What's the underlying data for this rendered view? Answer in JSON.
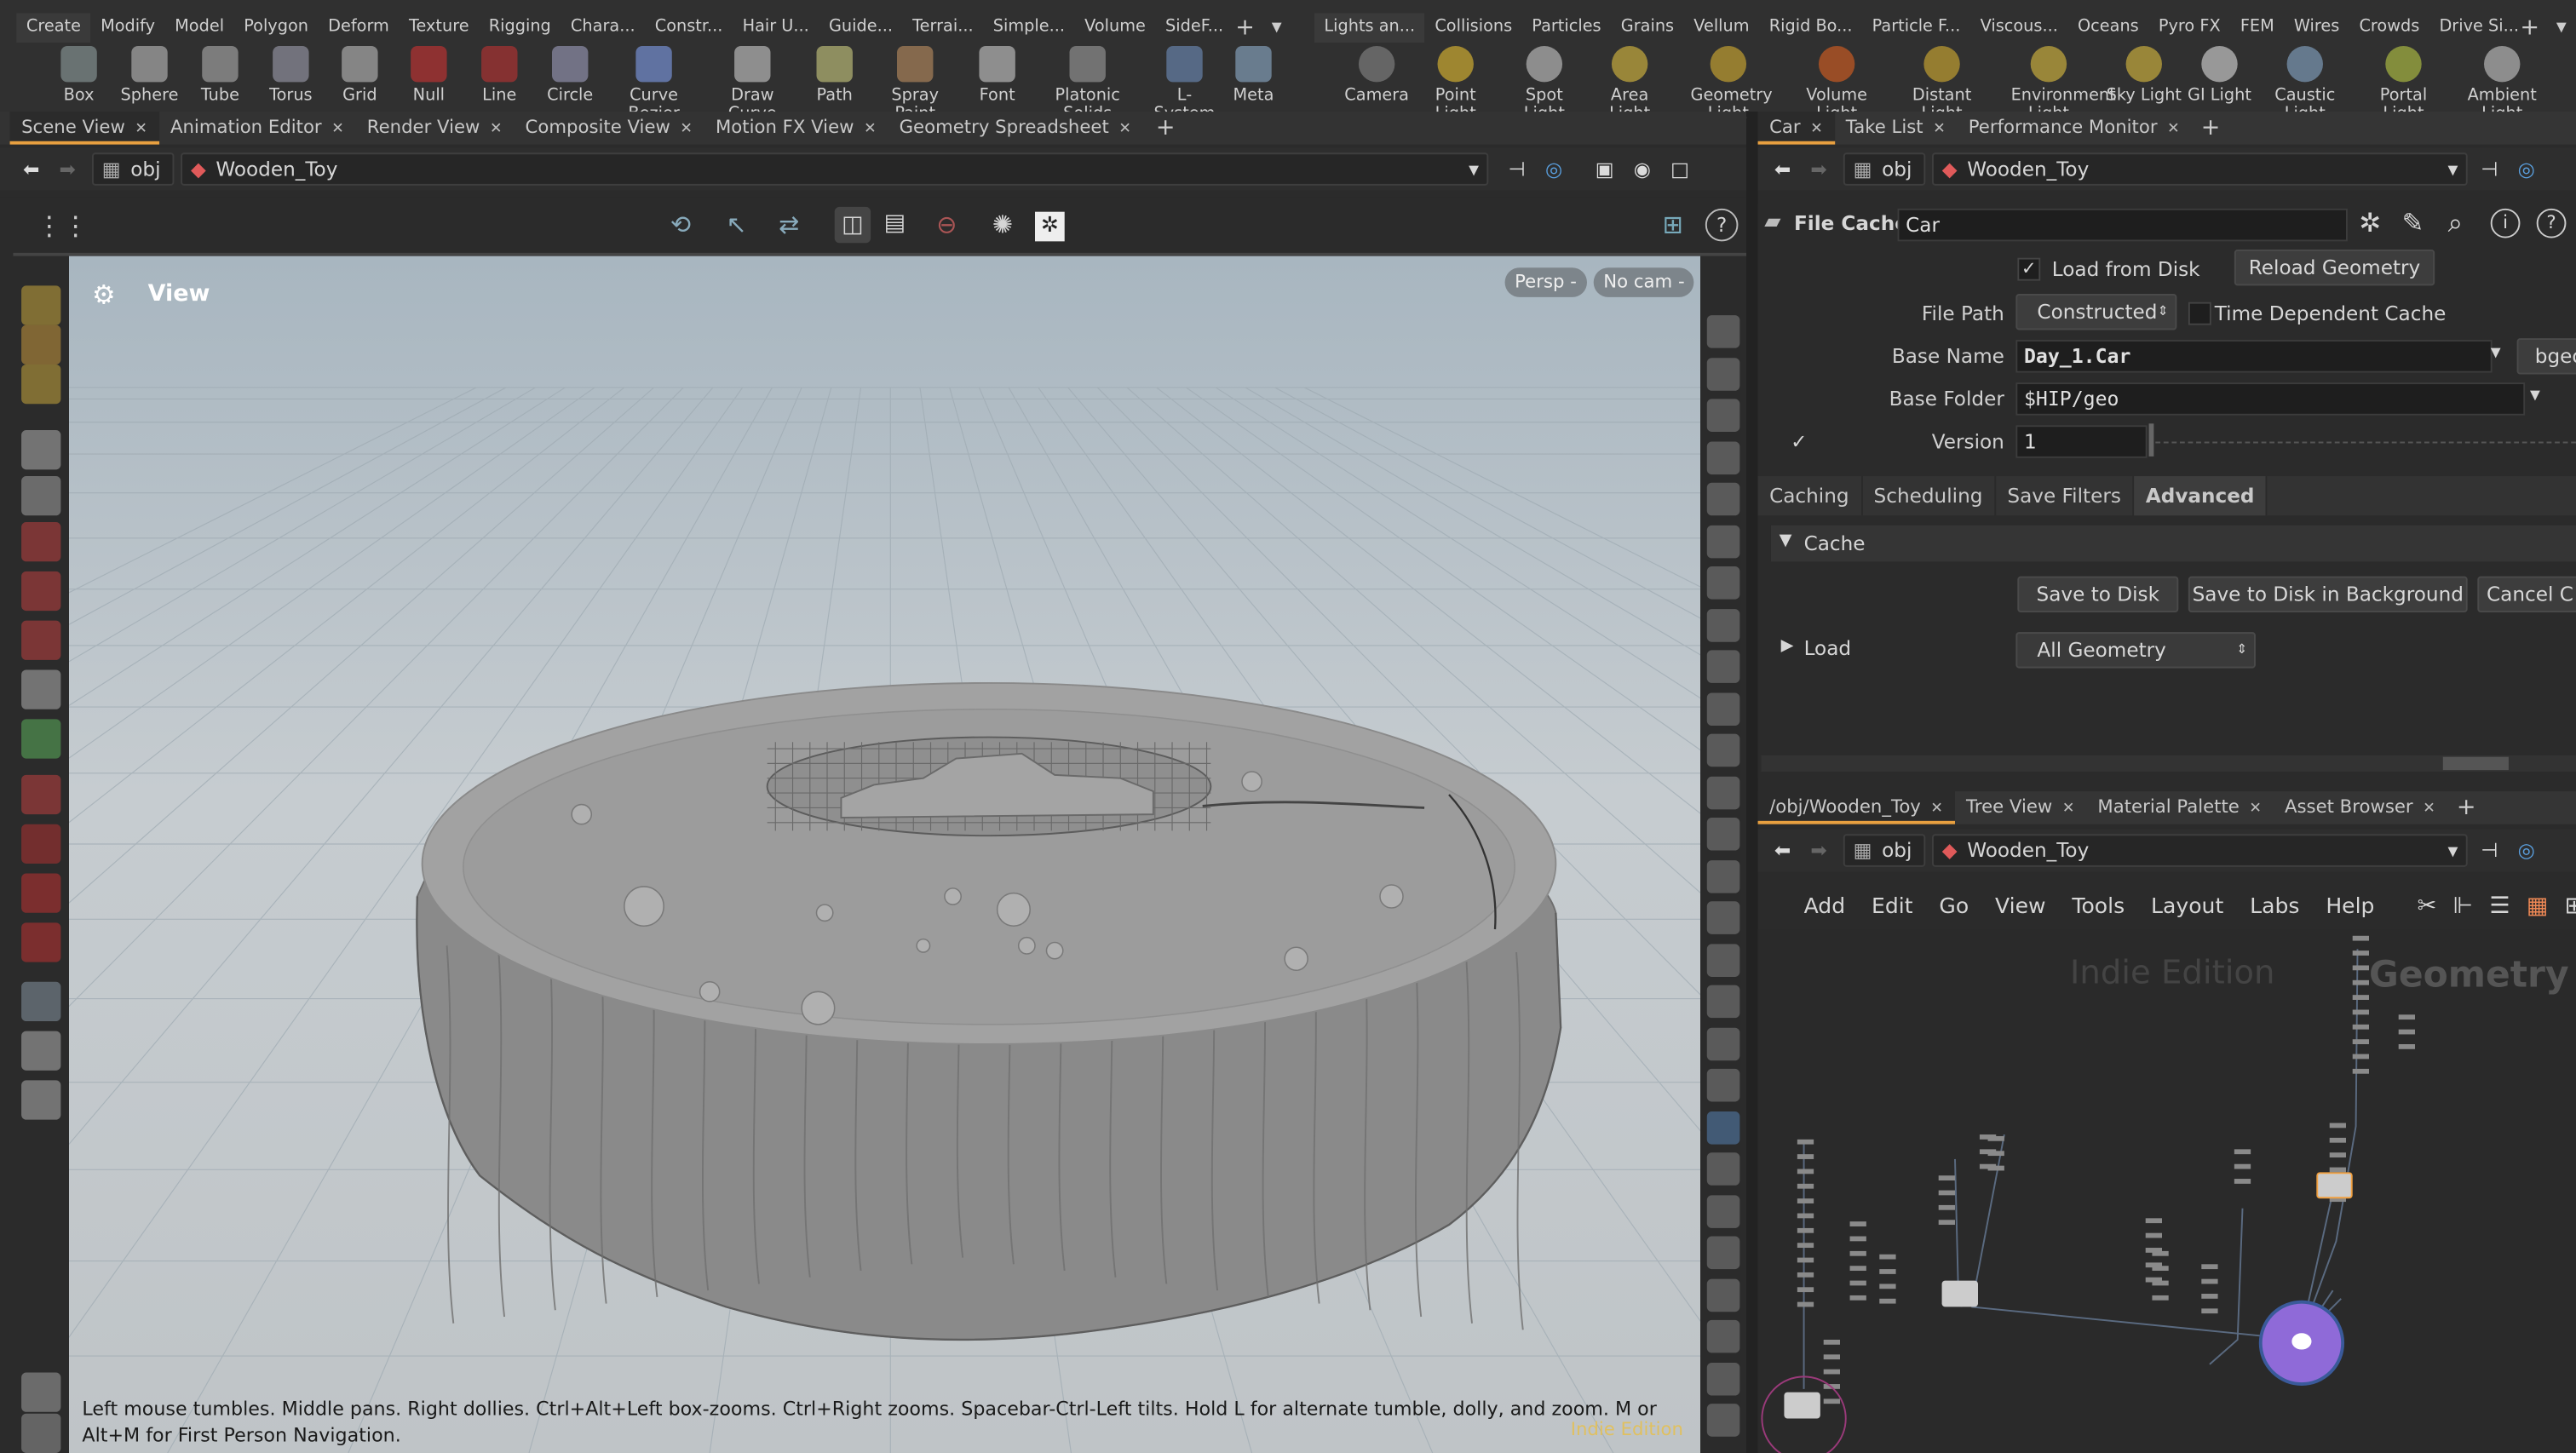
{
  "shelf_tabs_left": [
    "Create",
    "Modify",
    "Model",
    "Polygon",
    "Deform",
    "Texture",
    "Rigging",
    "Chara...",
    "Constr...",
    "Hair U...",
    "Guide...",
    "Terrai...",
    "Simple...",
    "Volume",
    "SideF..."
  ],
  "shelf_tabs_right": [
    "Lights an...",
    "Collisions",
    "Particles",
    "Grains",
    "Vellum",
    "Rigid Bo...",
    "Particle F...",
    "Viscous...",
    "Oceans",
    "Pyro FX",
    "FEM",
    "Wires",
    "Crowds",
    "Drive Si..."
  ],
  "tools_left": [
    {
      "label": "Box",
      "icon": "box-icon"
    },
    {
      "label": "Sphere",
      "icon": "sphere-icon"
    },
    {
      "label": "Tube",
      "icon": "tube-icon"
    },
    {
      "label": "Torus",
      "icon": "torus-icon"
    },
    {
      "label": "Grid",
      "icon": "grid-icon"
    },
    {
      "label": "Null",
      "icon": "null-icon"
    },
    {
      "label": "Line",
      "icon": "line-icon"
    },
    {
      "label": "Circle",
      "icon": "circle-icon"
    },
    {
      "label": "Curve Bezier",
      "icon": "curve-bezier-icon"
    },
    {
      "label": "Draw Curve",
      "icon": "draw-curve-icon"
    },
    {
      "label": "Path",
      "icon": "path-icon"
    },
    {
      "label": "Spray Paint",
      "icon": "spray-paint-icon"
    },
    {
      "label": "Font",
      "icon": "font-icon"
    },
    {
      "label": "Platonic Solids",
      "icon": "platonic-icon"
    },
    {
      "label": "L-System",
      "icon": "lsystem-icon"
    },
    {
      "label": "Meta",
      "icon": "meta-icon"
    }
  ],
  "tools_right": [
    {
      "label": "Camera",
      "icon": "camera-icon"
    },
    {
      "label": "Point Light",
      "icon": "point-light-icon"
    },
    {
      "label": "Spot Light",
      "icon": "spot-light-icon"
    },
    {
      "label": "Area Light",
      "icon": "area-light-icon"
    },
    {
      "label": "Geometry Light",
      "icon": "geometry-light-icon"
    },
    {
      "label": "Volume Light",
      "icon": "volume-light-icon"
    },
    {
      "label": "Distant Light",
      "icon": "distant-light-icon"
    },
    {
      "label": "Environment Light",
      "icon": "environment-light-icon"
    },
    {
      "label": "Sky Light",
      "icon": "sky-light-icon"
    },
    {
      "label": "GI Light",
      "icon": "gi-light-icon"
    },
    {
      "label": "Caustic Light",
      "icon": "caustic-light-icon"
    },
    {
      "label": "Portal Light",
      "icon": "portal-light-icon"
    },
    {
      "label": "Ambient Light",
      "icon": "ambient-light-icon"
    }
  ],
  "left_pane_tabs": [
    "Scene View",
    "Animation Editor",
    "Render View",
    "Composite View",
    "Motion FX View",
    "Geometry Spreadsheet"
  ],
  "right_pane_tabs": [
    "Car",
    "Take List",
    "Performance Monitor"
  ],
  "net_pane_tabs": [
    "/obj/Wooden_Toy",
    "Tree View",
    "Material Palette",
    "Asset Browser"
  ],
  "path": {
    "root": "obj",
    "node": "Wooden_Toy"
  },
  "viewport": {
    "title": "View",
    "persp": "Persp -",
    "cam": "No cam -",
    "status": "Left mouse tumbles. Middle pans. Right dollies. Ctrl+Alt+Left box-zooms. Ctrl+Right zooms. Spacebar-Ctrl-Left tilts. Hold L for alternate tumble, dolly, and zoom. M or Alt+M for First Person Navigation.",
    "watermark": "Indie Edition"
  },
  "parms": {
    "type": "File Cache",
    "name": "Car",
    "load_from_disk": "Load from Disk",
    "reload": "Reload Geometry",
    "file_path_label": "File Path",
    "file_path_value": "Constructed",
    "time_dep": "Time Dependent Cache",
    "base_name_label": "Base Name",
    "base_name": "Day_1.Car",
    "bgeo": "bgeo",
    "base_folder_label": "Base Folder",
    "base_folder": "$HIP/geo",
    "version_label": "Version",
    "version": "1",
    "tabs": [
      "Caching",
      "Scheduling",
      "Save Filters",
      "Advanced"
    ],
    "cache_section": "Cache",
    "save": "Save to Disk",
    "save_bg": "Save to Disk in Background",
    "cancel": "Cancel C",
    "load_section": "Load",
    "load_value": "All Geometry"
  },
  "net_menu": [
    "Add",
    "Edit",
    "Go",
    "View",
    "Tools",
    "Layout",
    "Labs",
    "Help"
  ],
  "net_watermark": "Indie Edition",
  "net_context": "Geometry"
}
